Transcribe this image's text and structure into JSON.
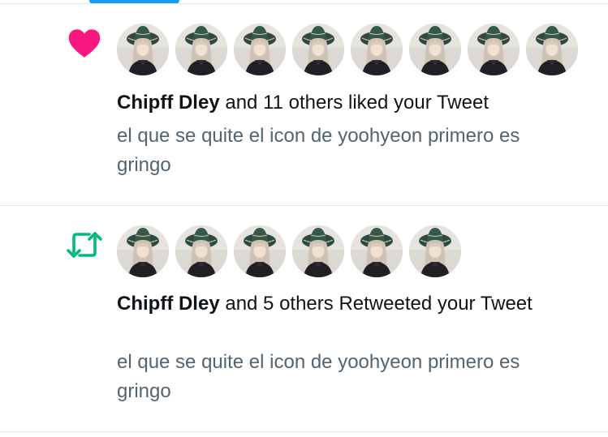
{
  "colors": {
    "like": "#f91880",
    "retweet": "#00ba7c",
    "secondary_text": "#536471",
    "primary_text": "#0f1419",
    "tab_indicator": "#1d9bf0",
    "divider": "#e3e6e8"
  },
  "notifications": [
    {
      "type": "like",
      "icon": "heart-icon",
      "avatar_count": 8,
      "user": "Chipff Dley",
      "action_text": "and 11 others liked your Tweet",
      "tweet_text": "el que se quite el icon de yoohyeon primero es gringo"
    },
    {
      "type": "retweet",
      "icon": "retweet-icon",
      "avatar_count": 6,
      "user": "Chipff Dley",
      "action_text": "and 5 others Retweeted your Tweet",
      "tweet_text": "el que se quite el icon de yoohyeon primero es gringo"
    }
  ]
}
